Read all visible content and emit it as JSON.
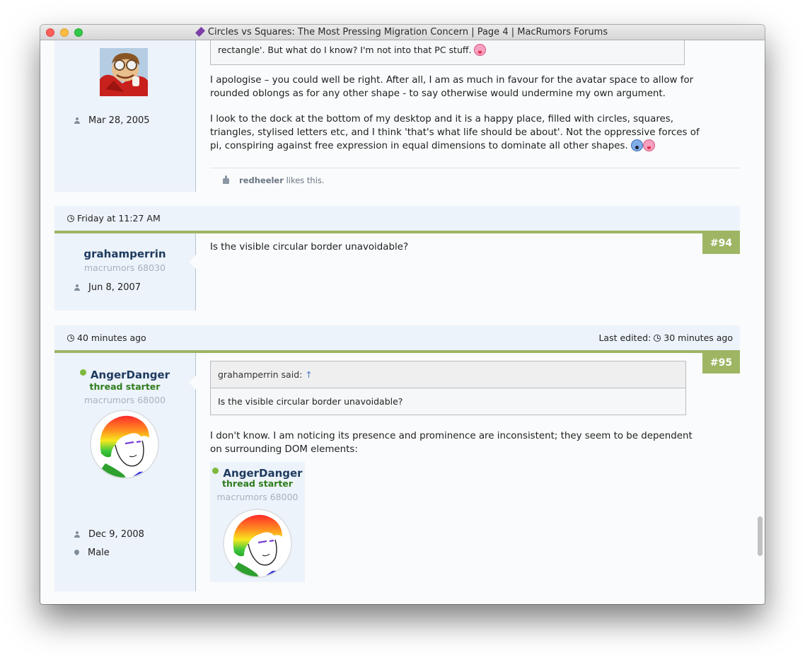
{
  "window": {
    "title": "Circles vs Squares: The Most Pressing Migration Concern | Page 4 | MacRumors Forums"
  },
  "post_prev": {
    "join_date": "Mar 28, 2005",
    "quote_visible_text": "rectangle'. But what do I know? I'm not into that PC stuff.",
    "paragraphs": [
      "I apologise – you could well be right. After all, I am as much in favour for the avatar space to allow for rounded oblongs as for any other shape - to say otherwise would undermine my own argument.",
      "I look to the dock at the bottom of my desktop and it is a happy place, filled with circles, squares, triangles, stylised letters etc, and I think 'that's what life should be about'. Not the oppressive forces of pi, conspiring against free expression in equal dimensions to dominate all other shapes."
    ],
    "likes": {
      "user": "redheeler",
      "suffix": "likes this."
    }
  },
  "post_94": {
    "date": "Friday at 11:27 AM",
    "number": "#94",
    "username": "grahamperrin",
    "rank": "macrumors 68030",
    "join_date": "Jun 8, 2007",
    "message": "Is the visible circular border unavoidable?"
  },
  "post_95": {
    "date": "40 minutes ago",
    "edited_label": "Last edited:",
    "edited_time": "30 minutes ago",
    "number": "#95",
    "username": "AngerDanger",
    "starter_label": "thread starter",
    "rank": "macrumors 68000",
    "join_date": "Dec 9, 2008",
    "gender": "Male",
    "quote": {
      "author": "grahamperrin said:",
      "arrow": "↑",
      "text": "Is the visible circular border unavoidable?"
    },
    "message": "I don't know. I am noticing its presence and prominence are inconsistent; they seem to be dependent on surrounding DOM elements:",
    "embedded_card": {
      "username": "AngerDanger",
      "starter_label": "thread starter",
      "rank": "macrumors 68000"
    }
  },
  "colors": {
    "accent_green": "#9eb563",
    "userpanel_bg": "#edf3fa",
    "online_dot": "#7fb93d",
    "starter_green": "#2e7d1e"
  }
}
